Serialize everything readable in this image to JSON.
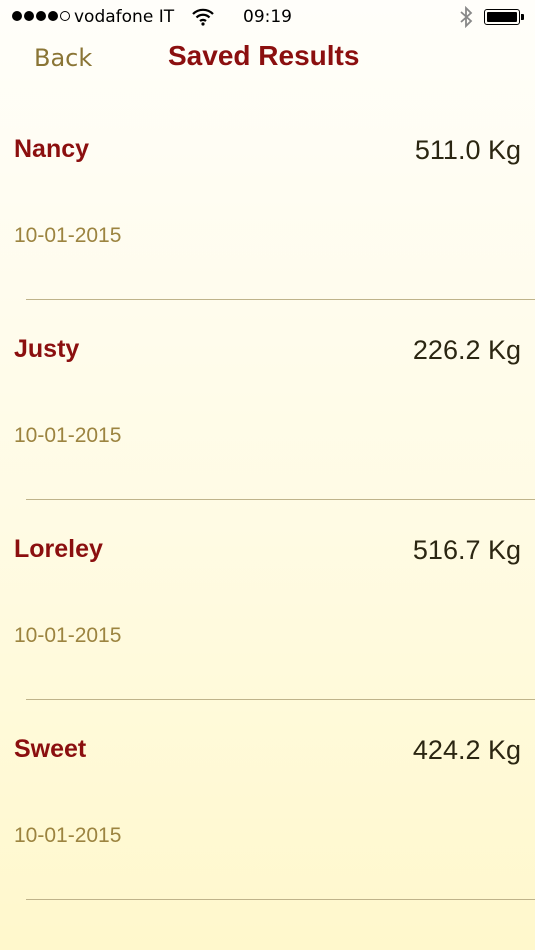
{
  "status_bar": {
    "carrier": "vodafone IT",
    "time": "09:19",
    "signal_icon": "signal-dots-icon",
    "wifi_icon": "wifi-icon",
    "bluetooth_icon": "bluetooth-icon",
    "battery_icon": "battery-icon"
  },
  "nav": {
    "back_label": "Back",
    "title": "Saved Results"
  },
  "colors": {
    "title": "#8b0f0f",
    "back": "#8a7535",
    "date": "#9c8440",
    "weight": "#2b2612"
  },
  "results": [
    {
      "name": "Nancy",
      "weight": "511.0 Kg",
      "date": "10-01-2015"
    },
    {
      "name": "Justy",
      "weight": "226.2 Kg",
      "date": "10-01-2015"
    },
    {
      "name": "Loreley",
      "weight": "516.7 Kg",
      "date": "10-01-2015"
    },
    {
      "name": "Sweet",
      "weight": "424.2 Kg",
      "date": "10-01-2015"
    }
  ]
}
